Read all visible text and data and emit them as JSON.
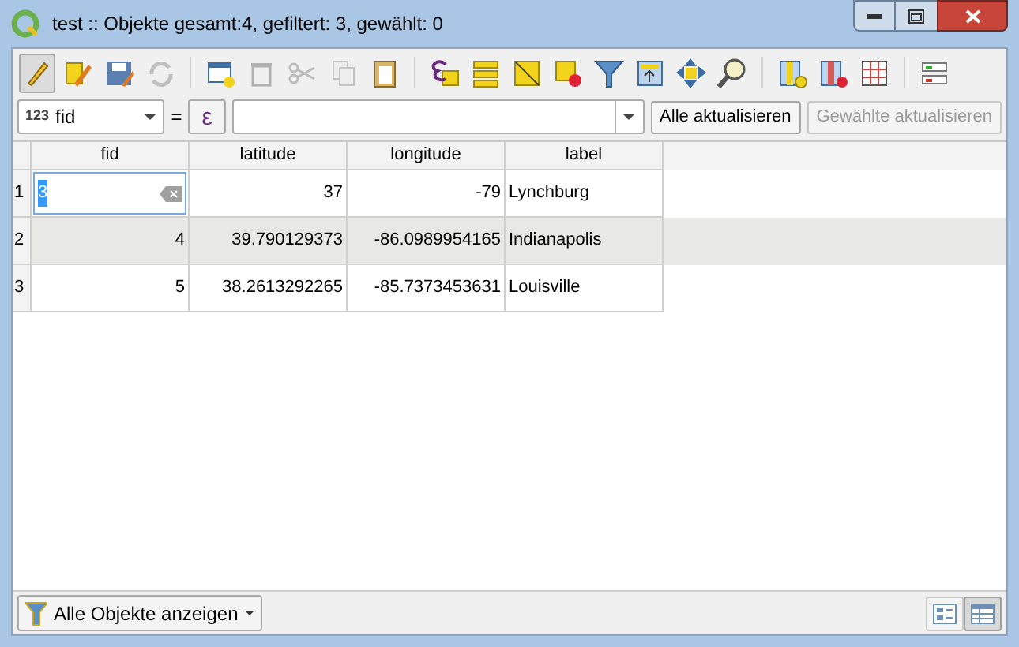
{
  "window": {
    "title": "test :: Objekte gesamt:4, gefiltert: 3, gewählt: 0"
  },
  "toolbar": [
    {
      "kind": "pencil",
      "selected": true,
      "disabled": false
    },
    {
      "kind": "multiedit",
      "selected": false,
      "disabled": false
    },
    {
      "kind": "save",
      "selected": false,
      "disabled": false
    },
    {
      "kind": "reload",
      "selected": false,
      "disabled": true
    },
    {
      "kind": "sep"
    },
    {
      "kind": "addrow",
      "selected": false,
      "disabled": false
    },
    {
      "kind": "trash",
      "selected": false,
      "disabled": true
    },
    {
      "kind": "scissors",
      "selected": false,
      "disabled": true
    },
    {
      "kind": "copy",
      "selected": false,
      "disabled": true
    },
    {
      "kind": "paste",
      "selected": false,
      "disabled": false
    },
    {
      "kind": "sep"
    },
    {
      "kind": "expression",
      "selected": false,
      "disabled": false
    },
    {
      "kind": "stack",
      "selected": false,
      "disabled": false
    },
    {
      "kind": "invert",
      "selected": false,
      "disabled": false
    },
    {
      "kind": "deselect",
      "selected": false,
      "disabled": false
    },
    {
      "kind": "filter",
      "selected": false,
      "disabled": false
    },
    {
      "kind": "totop",
      "selected": false,
      "disabled": false
    },
    {
      "kind": "pan",
      "selected": false,
      "disabled": false
    },
    {
      "kind": "zoom",
      "selected": false,
      "disabled": false
    },
    {
      "kind": "sep"
    },
    {
      "kind": "addfield",
      "selected": false,
      "disabled": false
    },
    {
      "kind": "delfield",
      "selected": false,
      "disabled": false
    },
    {
      "kind": "calc",
      "selected": false,
      "disabled": false
    },
    {
      "kind": "sep"
    },
    {
      "kind": "format",
      "selected": false,
      "disabled": false
    }
  ],
  "field_bar": {
    "field_type": "123",
    "field": "fid",
    "equals": "=",
    "expression_button": "ε",
    "buttons": [
      {
        "label": "Alle aktualisieren",
        "disabled": false
      },
      {
        "label": "Gewählte aktualisieren",
        "disabled": true
      }
    ]
  },
  "table": {
    "columns": [
      "fid",
      "latitude",
      "longitude",
      "label"
    ],
    "rows": [
      {
        "number": "1",
        "cells": [
          {
            "value": "3",
            "editing": true
          },
          {
            "value": "37",
            "editing": false
          },
          {
            "value": "-79",
            "editing": false
          },
          {
            "value": "Lynchburg",
            "editing": false
          }
        ]
      },
      {
        "number": "2",
        "cells": [
          {
            "value": "4",
            "editing": false
          },
          {
            "value": "39.790129373",
            "editing": false
          },
          {
            "value": "-86.0989954165",
            "editing": false
          },
          {
            "value": "Indianapolis",
            "editing": false
          }
        ]
      },
      {
        "number": "3",
        "cells": [
          {
            "value": "5",
            "editing": false
          },
          {
            "value": "38.2613292265",
            "editing": false
          },
          {
            "value": "-85.7373453631",
            "editing": false
          },
          {
            "value": "Louisville",
            "editing": false
          }
        ]
      }
    ]
  },
  "bottom_bar": {
    "filter_button": "Alle Objekte anzeigen",
    "views": [
      {
        "kind": "form",
        "selected": false
      },
      {
        "kind": "table",
        "selected": true
      }
    ]
  }
}
